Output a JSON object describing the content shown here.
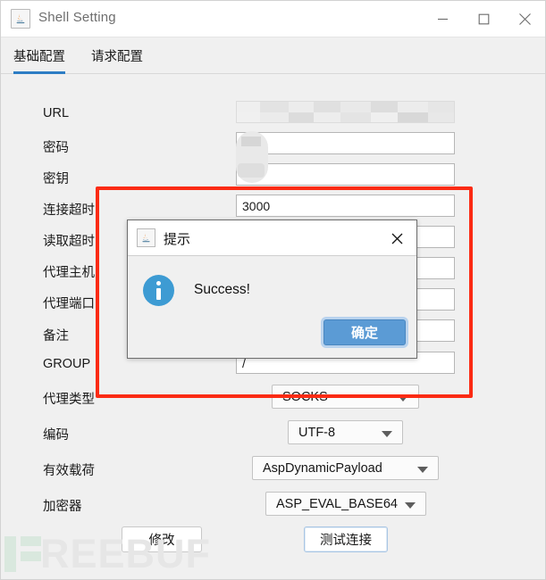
{
  "window": {
    "title": "Shell Setting",
    "icon": "java-icon",
    "controls": {
      "minimize": "minimize-icon",
      "maximize": "maximize-icon",
      "close": "close-icon"
    }
  },
  "tabs": [
    {
      "label": "基础配置",
      "active": true
    },
    {
      "label": "请求配置",
      "active": false
    }
  ],
  "form": {
    "fields": [
      {
        "label": "URL",
        "value": "",
        "type": "text-blurred"
      },
      {
        "label": "密码",
        "value": "",
        "type": "text-blurred"
      },
      {
        "label": "密钥",
        "value": "",
        "type": "text-blurred"
      },
      {
        "label": "连接超时",
        "value": "3000",
        "type": "text"
      },
      {
        "label": "读取超时",
        "value": "",
        "type": "text"
      },
      {
        "label": "代理主机",
        "value": "",
        "type": "text"
      },
      {
        "label": "代理端口",
        "value": "",
        "type": "text"
      },
      {
        "label": "备注",
        "value": "",
        "type": "textarea"
      },
      {
        "label": "GROUP",
        "value": "/",
        "type": "text"
      }
    ],
    "combos": [
      {
        "label": "代理类型",
        "value": "SOCKS"
      },
      {
        "label": "编码",
        "value": "UTF-8"
      },
      {
        "label": "有效载荷",
        "value": "AspDynamicPayload"
      },
      {
        "label": "加密器",
        "value": "ASP_EVAL_BASE64"
      }
    ]
  },
  "buttons": {
    "modify": "修改",
    "test_connection": "测试连接"
  },
  "dialog": {
    "title": "提示",
    "icon": "java-icon",
    "close": "close-icon",
    "info_icon": "info-icon",
    "message": "Success!",
    "ok_label": "确定"
  },
  "watermark": {
    "text": "REEBUF"
  },
  "colors": {
    "accent": "#2d7dc4",
    "annotation": "#fb2b14",
    "info": "#3d9bd3",
    "default_button": "#5b9bd5",
    "window_bg": "#f0f0f0"
  }
}
